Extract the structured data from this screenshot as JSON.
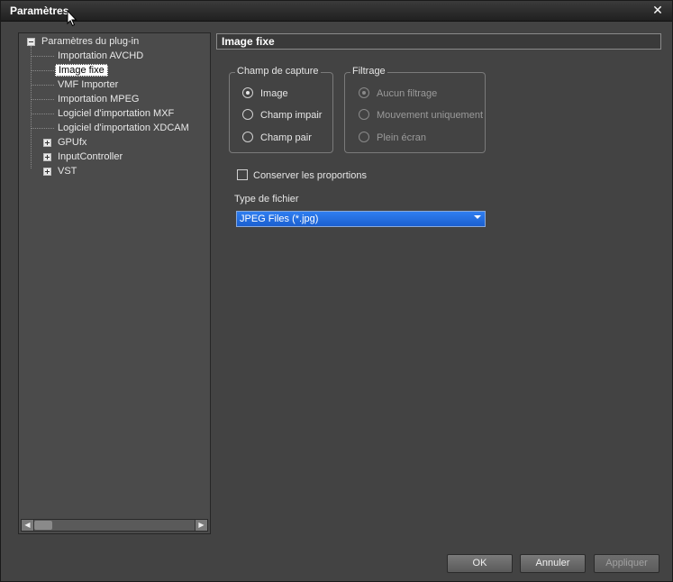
{
  "window": {
    "title": "Paramètres",
    "close_glyph": "✕"
  },
  "tree": {
    "root": {
      "label": "Paramètres du plug-in"
    },
    "children": [
      {
        "label": "Importation AVCHD"
      },
      {
        "label": "Image fixe",
        "selected": true
      },
      {
        "label": "VMF Importer"
      },
      {
        "label": "Importation MPEG"
      },
      {
        "label": "Logiciel d'importation MXF"
      },
      {
        "label": "Logiciel d'importation XDCAM"
      }
    ],
    "siblings": [
      {
        "label": "GPUfx"
      },
      {
        "label": "InputController"
      },
      {
        "label": "VST"
      }
    ]
  },
  "panel": {
    "header": "Image fixe",
    "capture_group": {
      "legend": "Champ de capture",
      "options": [
        {
          "label": "Image",
          "checked": true
        },
        {
          "label": "Champ impair",
          "checked": false
        },
        {
          "label": "Champ pair",
          "checked": false
        }
      ]
    },
    "filter_group": {
      "legend": "Filtrage",
      "options": [
        {
          "label": "Aucun filtrage",
          "checked": true
        },
        {
          "label": "Mouvement uniquement",
          "checked": false
        },
        {
          "label": "Plein écran",
          "checked": false
        }
      ]
    },
    "keep_ratio": {
      "label": "Conserver les proportions",
      "checked": false
    },
    "file_type": {
      "label": "Type de fichier",
      "value": "JPEG Files (*.jpg)"
    }
  },
  "buttons": {
    "ok": "OK",
    "cancel": "Annuler",
    "apply": "Appliquer"
  },
  "colors": {
    "window_bg": "#434343",
    "select_bg": "#1b5fd0"
  }
}
